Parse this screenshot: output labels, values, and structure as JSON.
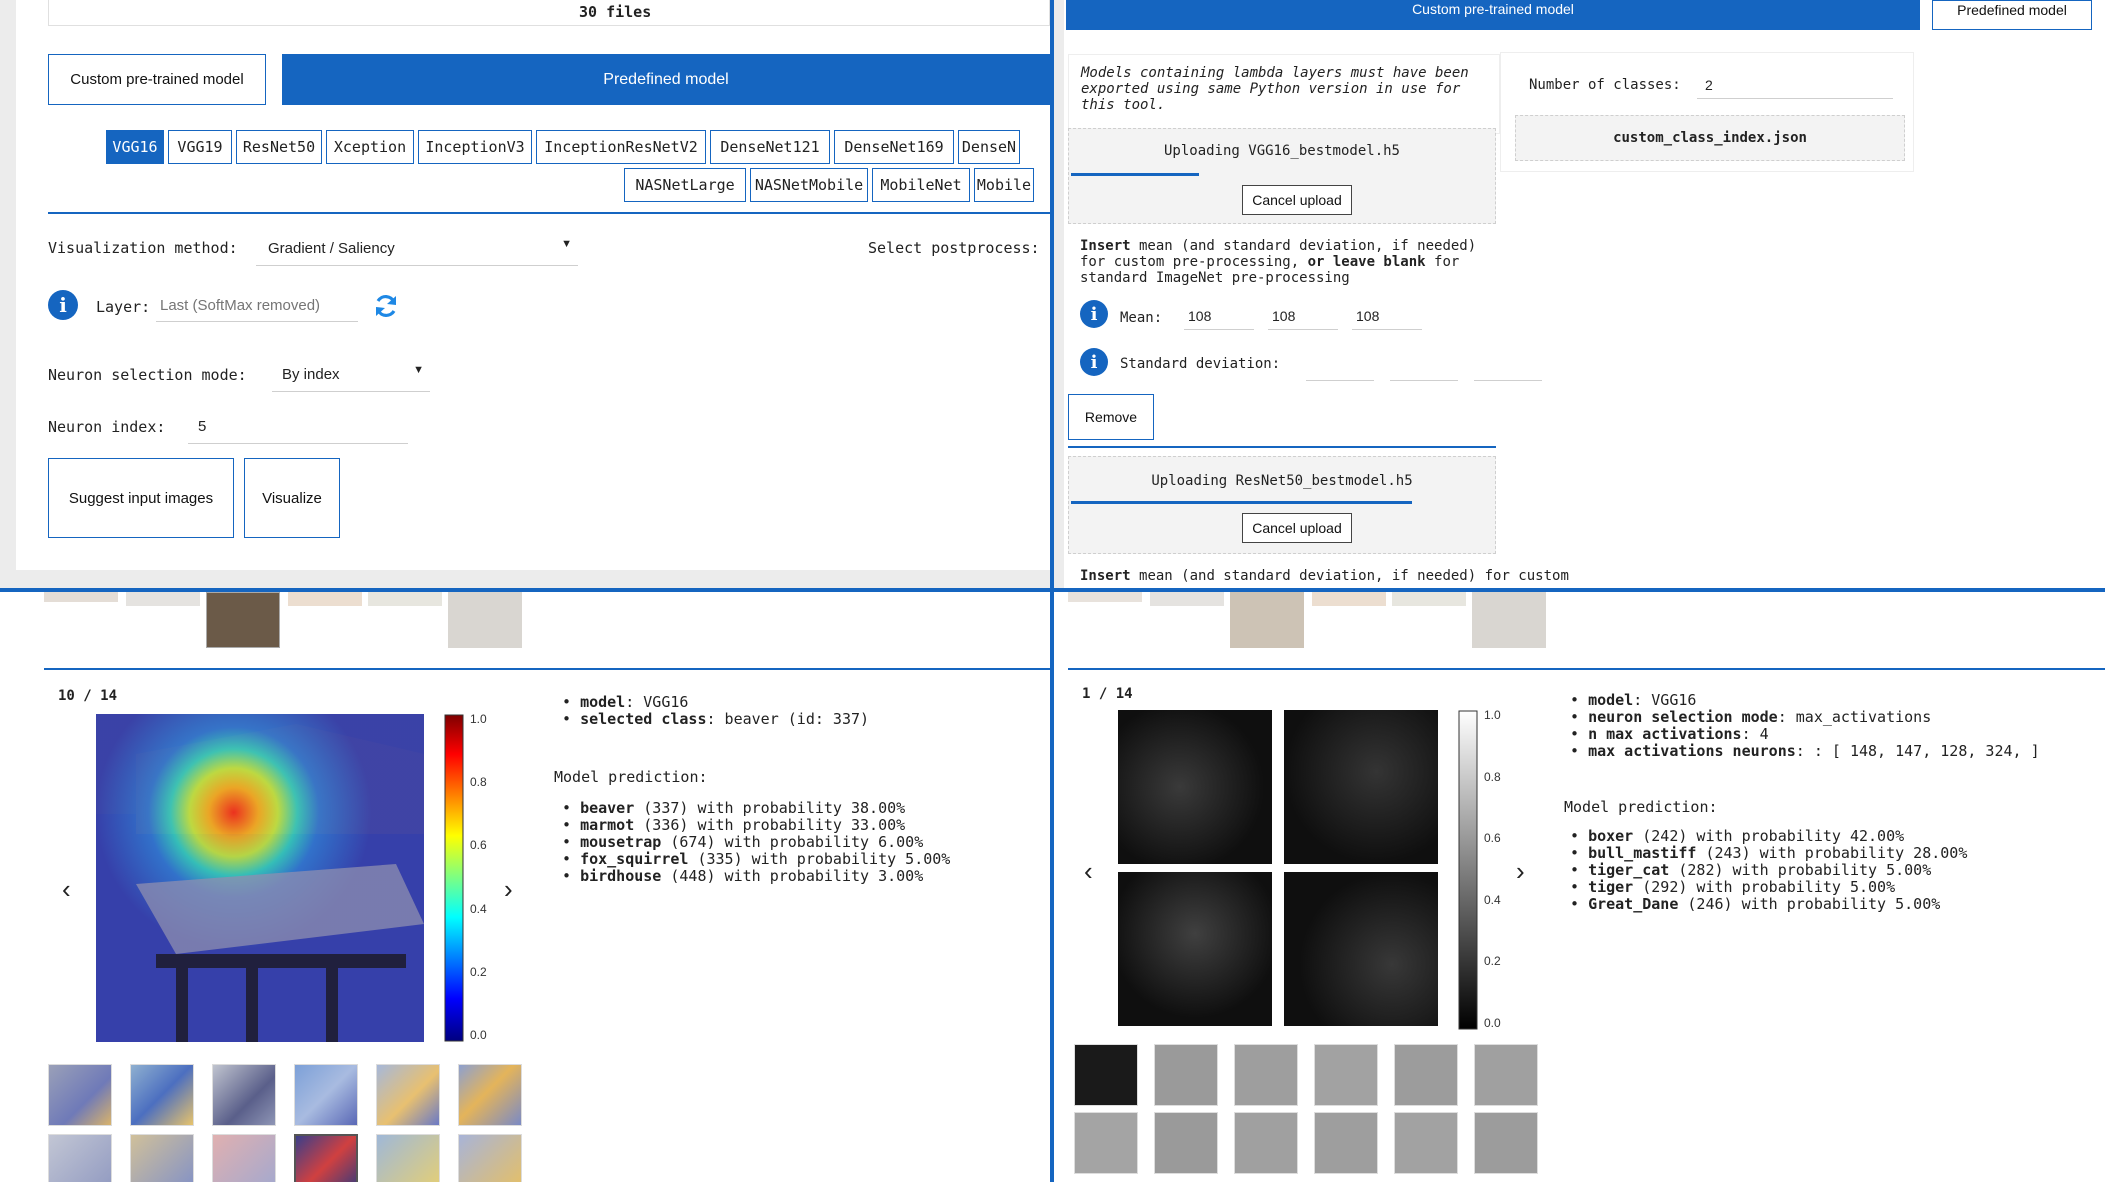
{
  "q1": {
    "files_count": "30 files",
    "tab_custom": "Custom pre-trained model",
    "tab_predefined": "Predefined model",
    "models_row1": [
      "VGG16",
      "VGG19",
      "ResNet50",
      "Xception",
      "InceptionV3",
      "InceptionResNetV2",
      "DenseNet121",
      "DenseNet169",
      "DenseN"
    ],
    "models_row2": [
      "NASNetLarge",
      "NASNetMobile",
      "MobileNet",
      "Mobile"
    ],
    "selected_model": "VGG16",
    "vis_method_label": "Visualization method:",
    "vis_method_value": "Gradient / Saliency",
    "postprocess_label": "Select postprocess:",
    "layer_label": "Layer:",
    "layer_placeholder": "Last (SoftMax removed)",
    "neuron_mode_label": "Neuron selection mode:",
    "neuron_mode_value": "By index",
    "neuron_index_label": "Neuron index:",
    "neuron_index_value": "5",
    "suggest_button": "Suggest input images",
    "visualize_button": "Visualize"
  },
  "q2": {
    "tab_custom": "Custom pre-trained model",
    "tab_predefined": "Predefined model",
    "lambda_note": "Models containing lambda layers must have been exported using same Python version in use for this tool.",
    "upload1": {
      "title": "Uploading VGG16_bestmodel.h5",
      "progress": 0.3,
      "cancel": "Cancel upload"
    },
    "insert_text_bold1": "Insert",
    "insert_text_1": " mean (and standard deviation, if needed) for custom pre-processing, ",
    "insert_text_bold2": "or leave blank",
    "insert_text_2": " for standard ImageNet pre-processing",
    "mean_label": "Mean:",
    "mean_values": [
      "108",
      "108",
      "108"
    ],
    "std_label": "Standard deviation:",
    "remove_button": "Remove",
    "upload2": {
      "title": "Uploading ResNet50_bestmodel.h5",
      "progress": 0.8,
      "cancel": "Cancel upload"
    },
    "insert_text_tail": "mean (and standard deviation, if needed) for custom",
    "num_classes_label": "Number of classes:",
    "num_classes_value": "2",
    "class_index_file": "custom_class_index.json"
  },
  "q3": {
    "counter": "10 / 14",
    "info": [
      {
        "key": "model",
        "value": ": VGG16"
      },
      {
        "key": "selected class",
        "value": ": beaver (id: 337)"
      }
    ],
    "prediction_title": "Model prediction:",
    "predictions": [
      {
        "name": "beaver",
        "rest": " (337) with probability 38.00%"
      },
      {
        "name": "marmot",
        "rest": " (336) with probability 33.00%"
      },
      {
        "name": "mousetrap",
        "rest": " (674) with probability 6.00%"
      },
      {
        "name": "fox_squirrel",
        "rest": " (335) with probability 5.00%"
      },
      {
        "name": "birdhouse",
        "rest": " (448) with probability 3.00%"
      }
    ],
    "colorbar_ticks": [
      "1.0",
      "0.8",
      "0.6",
      "0.4",
      "0.2",
      "0.0"
    ],
    "prev_arrow": "‹",
    "next_arrow": "›"
  },
  "q4": {
    "counter": "1 / 14",
    "info": [
      {
        "key": "model",
        "value": ": VGG16"
      },
      {
        "key": "neuron selection mode",
        "value": ": max_activations"
      },
      {
        "key": "n max activations",
        "value": ": 4"
      },
      {
        "key": "max activations neurons",
        "value": ": : [ 148, 147, 128, 324, ]"
      }
    ],
    "prediction_title": "Model prediction:",
    "predictions": [
      {
        "name": "boxer",
        "rest": " (242) with probability 42.00%"
      },
      {
        "name": "bull_mastiff",
        "rest": " (243) with probability 28.00%"
      },
      {
        "name": "tiger_cat",
        "rest": " (282) with probability 5.00%"
      },
      {
        "name": "tiger",
        "rest": " (292) with probability 5.00%"
      },
      {
        "name": "Great_Dane",
        "rest": " (246) with probability 5.00%"
      }
    ],
    "colorbar_ticks": [
      "1.0",
      "0.8",
      "0.6",
      "0.4",
      "0.2",
      "0.0"
    ],
    "prev_arrow": "‹",
    "next_arrow": "›"
  },
  "colors": {
    "accent": "#1565c0",
    "panel_bg": "#ffffff",
    "page_bg": "#ececec"
  }
}
